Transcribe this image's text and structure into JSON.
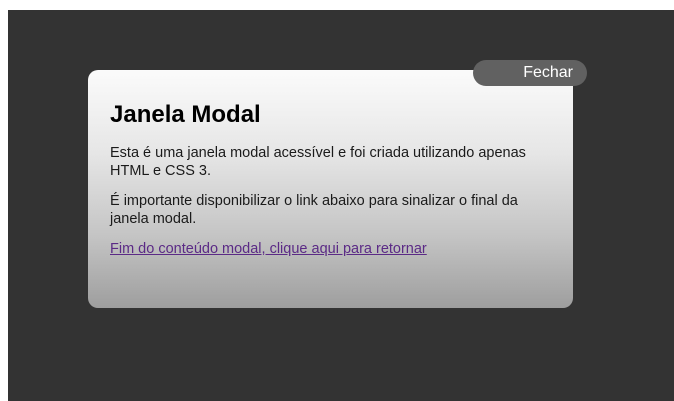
{
  "modal": {
    "close_label": "Fechar",
    "title": "Janela Modal",
    "paragraph_1": "Esta é uma janela modal acessível e foi criada utilizando apenas HTML e CSS 3.",
    "paragraph_2": "É importante disponibilizar o link abaixo para sinalizar o final da janela modal.",
    "return_link": "Fim do conteúdo modal, clique aqui para retornar"
  },
  "colors": {
    "backdrop": "#333333",
    "close_button": "#616161",
    "link": "#5b2a86"
  }
}
